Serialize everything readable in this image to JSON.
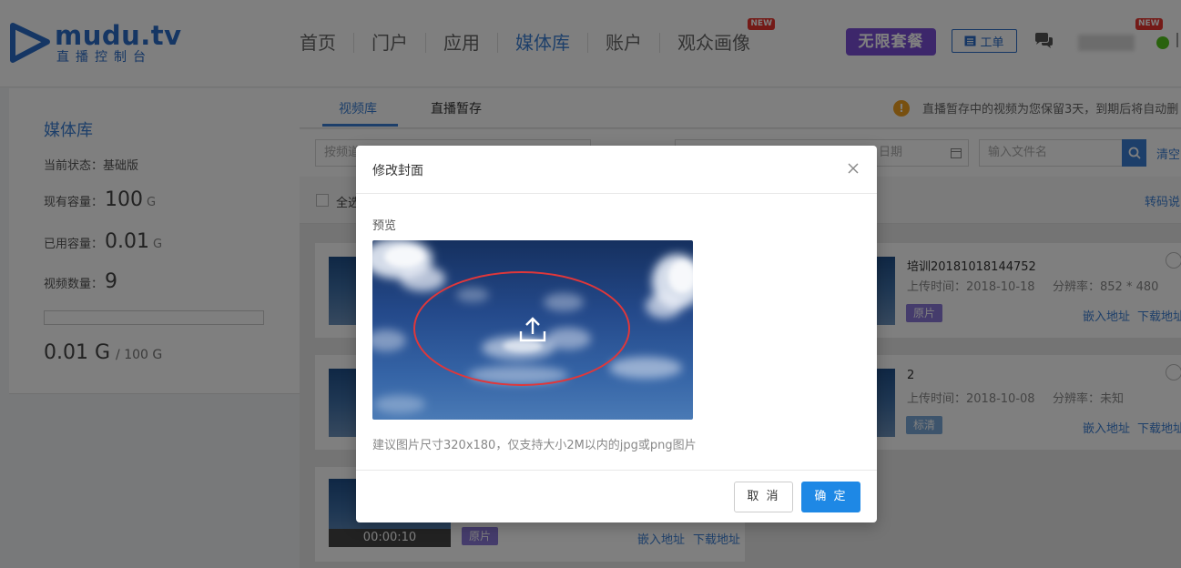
{
  "brand": {
    "name": "mudu.tv",
    "subtitle": "直播控制台"
  },
  "nav": {
    "items": [
      {
        "label": "首页"
      },
      {
        "label": "门户"
      },
      {
        "label": "应用"
      },
      {
        "label": "媒体库",
        "active": true
      },
      {
        "label": "账户"
      },
      {
        "label": "观众画像",
        "badge": "NEW"
      }
    ]
  },
  "header": {
    "unlimited_label": "无限套餐",
    "ticket_label": "工单",
    "user_badge": "NEW"
  },
  "sidebar": {
    "title": "媒体库",
    "status_label": "当前状态：",
    "status_value": "基础版",
    "capacity_label": "现有容量：",
    "capacity_value": "100",
    "capacity_unit": "G",
    "used_label": "已用容量：",
    "used_value": "0.01",
    "used_unit": "G",
    "count_label": "视频数量：",
    "count_value": "9",
    "usage_used": "0.01 G",
    "usage_total": "/ 100 G",
    "usage_fraction": 0.0001
  },
  "tabs": [
    {
      "label": "视频库",
      "active": true
    },
    {
      "label": "直播暂存",
      "active": false
    }
  ],
  "notice": "直播暂存中的视频为您保留3天，到期后将自动删",
  "filters": {
    "channel_placeholder": "按频道",
    "date_placeholder": "日期",
    "filename_placeholder": "输入文件名",
    "clear_label": "清空"
  },
  "select_all_label": "全选",
  "transcode_label": "转码说",
  "videos": [
    {
      "title": "培训20181018144752",
      "upload_label": "上传时间：",
      "upload_time": "2018-10-18",
      "res_label": "分辨率：",
      "resolution": "852 * 480",
      "tag": "原片",
      "embed": "嵌入地址",
      "download": "下载地址"
    },
    {
      "title": "2",
      "upload_label": "上传时间：",
      "upload_time": "2018-10-08",
      "res_label": "分辨率：",
      "resolution": "未知",
      "tag": "标清",
      "embed": "嵌入地址",
      "download": "下载地址"
    },
    {
      "duration": "00:00:10",
      "tag": "原片",
      "embed": "嵌入地址",
      "download": "下载地址"
    }
  ],
  "modal": {
    "title": "修改封面",
    "preview_label": "预览",
    "hint": "建议图片尺寸320x180，仅支持大小2M以内的jpg或png图片",
    "cancel_label": "取 消",
    "ok_label": "确 定"
  },
  "colors": {
    "brand": "#2a6dc8",
    "accent": "#1e88e5",
    "upgrade": "#7b4fd6",
    "highlight_ring": "#e0373a"
  }
}
